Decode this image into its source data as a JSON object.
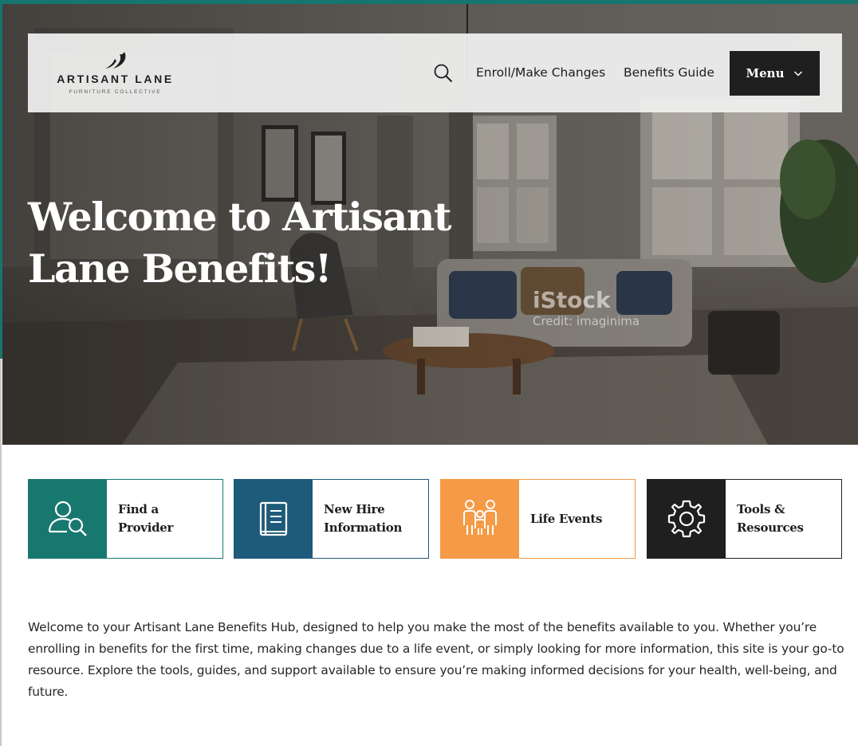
{
  "brand": {
    "name": "ARTISANT LANE",
    "tagline": "FURNITURE COLLECTIVE"
  },
  "header": {
    "search_icon": "search-icon",
    "nav": [
      {
        "label": "Enroll/Make Changes"
      },
      {
        "label": "Benefits Guide"
      }
    ],
    "menu_label": "Menu",
    "menu_icon": "chevron-down-icon"
  },
  "hero": {
    "title": "Welcome to Artisant Lane Benefits!",
    "watermark": "iStock",
    "credit": "Credit: imaginima"
  },
  "tiles": [
    {
      "label_line1": "Find a",
      "label_line2": "Provider",
      "icon": "person-search-icon",
      "color": "#17786f"
    },
    {
      "label_line1": "New Hire",
      "label_line2": "Information",
      "icon": "book-icon",
      "color": "#1e5a7a"
    },
    {
      "label_line1": "Life Events",
      "label_line2": "",
      "icon": "family-icon",
      "color": "#f59a47"
    },
    {
      "label_line1": "Tools &",
      "label_line2": "Resources",
      "icon": "gear-icon",
      "color": "#1f1f1f"
    }
  ],
  "intro": "Welcome to your Artisant Lane Benefits Hub, designed to help you make the most of the benefits available to you. Whether you’re enrolling in benefits for the first time, making changes due to a life event, or simply looking for more information, this site is your go-to resource. Explore the tools, guides, and support available to ensure you’re making informed decisions for your health, well-being, and future.",
  "colors": {
    "frame": "#16756f",
    "teal": "#17786f",
    "navy": "#1e5a7a",
    "orange": "#f59a47",
    "dark": "#1f1f1f"
  }
}
